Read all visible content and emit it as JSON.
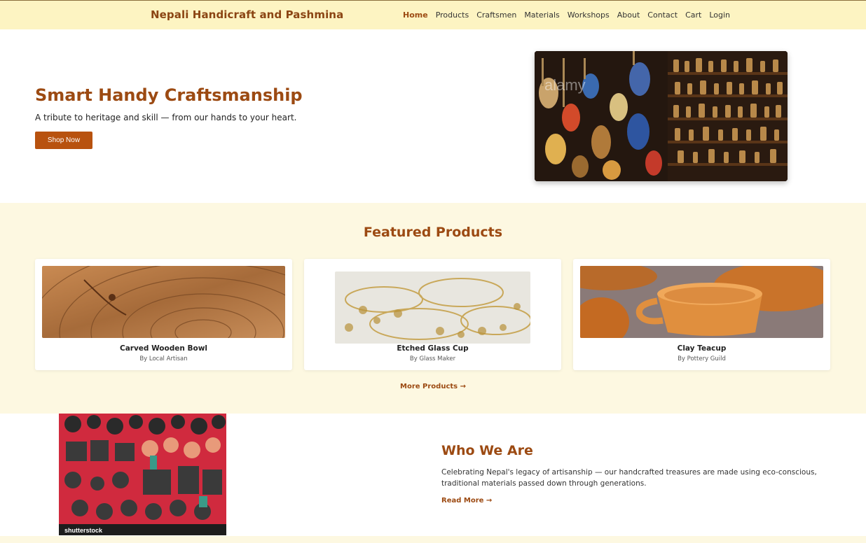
{
  "header": {
    "brand": "Nepali Handicraft and Pashmina",
    "nav": [
      "Home",
      "Products",
      "Craftsmen",
      "Materials",
      "Workshops",
      "About",
      "Contact",
      "Cart",
      "Login"
    ],
    "active_nav": "Home"
  },
  "hero": {
    "title": "Smart Handy Craftsmanship",
    "subtitle": "A tribute to heritage and skill — from our hands to your heart.",
    "button": "Shop Now",
    "image_watermark": "alamy"
  },
  "featured": {
    "title": "Featured Products",
    "products": [
      {
        "name": "Carved Wooden Bowl",
        "by": "By Local Artisan"
      },
      {
        "name": "Etched Glass Cup",
        "by": "By Glass Maker"
      },
      {
        "name": "Clay Teacup",
        "by": "By Pottery Guild"
      }
    ],
    "more_link": "More Products →"
  },
  "about": {
    "image_watermark": "shutterstock",
    "title": "Who We Are",
    "text": "Celebrating Nepal's legacy of artisanship — our handcrafted treasures are made using eco-conscious, traditional materials passed down through generations.",
    "read_more": "Read More →"
  },
  "colors": {
    "accent": "#9c4a12",
    "button": "#b8520f",
    "header_bg": "#fdf4c2",
    "section_bg": "#fdf8e1"
  }
}
